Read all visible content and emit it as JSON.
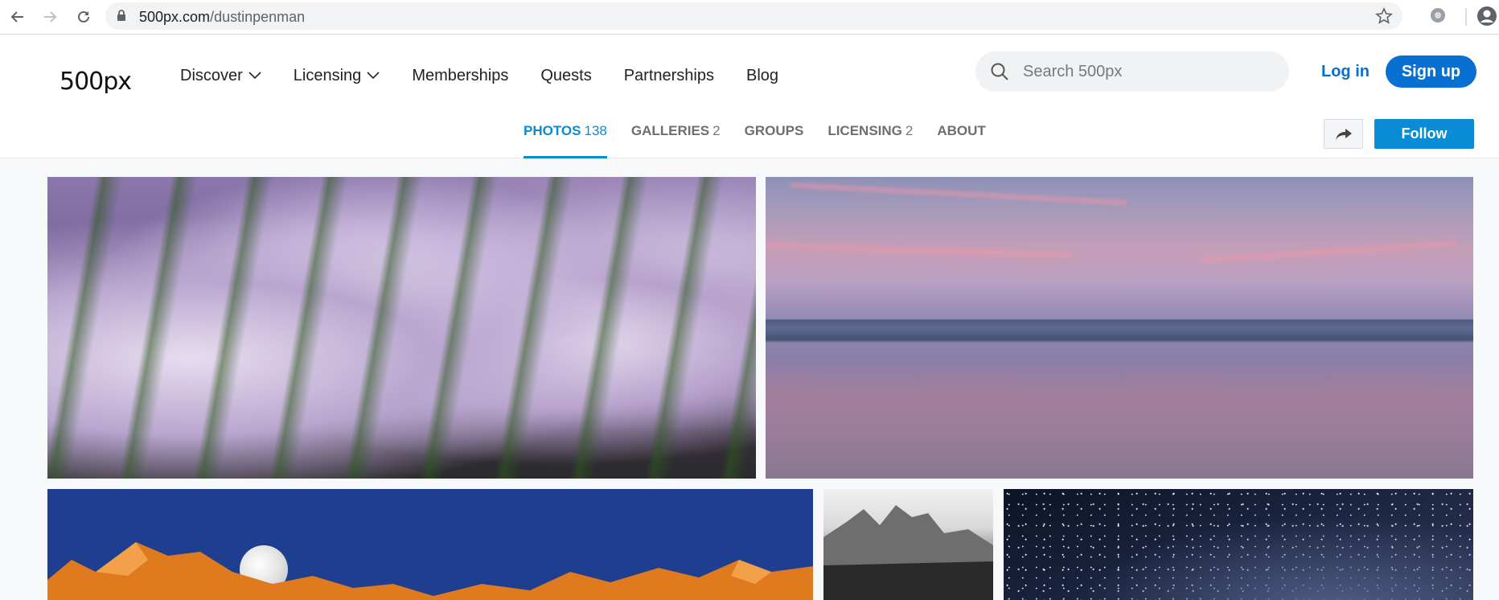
{
  "browser": {
    "url_host": "500px.com",
    "url_path": "/dustinpenman"
  },
  "header": {
    "logo_text": "500px",
    "nav": [
      {
        "label": "Discover",
        "has_dropdown": true
      },
      {
        "label": "Licensing",
        "has_dropdown": true
      },
      {
        "label": "Memberships",
        "has_dropdown": false
      },
      {
        "label": "Quests",
        "has_dropdown": false
      },
      {
        "label": "Partnerships",
        "has_dropdown": false
      },
      {
        "label": "Blog",
        "has_dropdown": false
      }
    ],
    "search_placeholder": "Search 500px",
    "login_label": "Log in",
    "signup_label": "Sign up"
  },
  "profile_tabs": [
    {
      "label": "PHOTOS",
      "count": "138",
      "active": true
    },
    {
      "label": "GALLERIES",
      "count": "2",
      "active": false
    },
    {
      "label": "GROUPS",
      "count": "",
      "active": false
    },
    {
      "label": "LICENSING",
      "count": "2",
      "active": false
    },
    {
      "label": "ABOUT",
      "count": "",
      "active": false
    }
  ],
  "actions": {
    "share_icon": "share-arrow-icon",
    "follow_label": "Follow"
  },
  "colors": {
    "brand_blue": "#0870d1",
    "tab_active": "#0a8bd6"
  },
  "photos": [
    {
      "subject": "orchard-blossoms"
    },
    {
      "subject": "lake-sunset"
    },
    {
      "subject": "mountain-moonrise"
    },
    {
      "subject": "granite-cliffs-bw"
    },
    {
      "subject": "starry-night-sky"
    }
  ]
}
